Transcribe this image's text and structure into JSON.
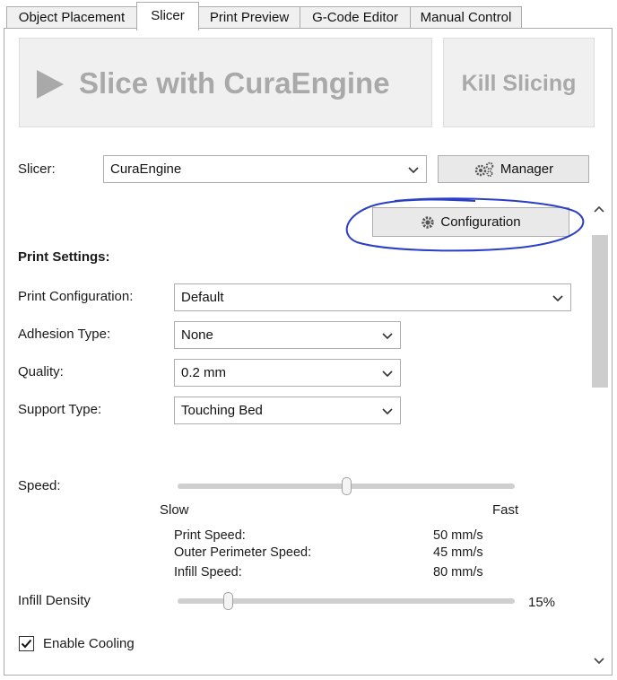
{
  "tabs": [
    {
      "label": "Object Placement"
    },
    {
      "label": "Slicer"
    },
    {
      "label": "Print Preview"
    },
    {
      "label": "G-Code Editor"
    },
    {
      "label": "Manual Control"
    }
  ],
  "actions": {
    "slice_label": "Slice with CuraEngine",
    "kill_label": "Kill Slicing"
  },
  "slicer": {
    "label": "Slicer:",
    "selected": "CuraEngine",
    "manager_label": "Manager",
    "configuration_label": "Configuration"
  },
  "print_settings": {
    "heading": "Print Settings:",
    "print_configuration": {
      "label": "Print Configuration:",
      "value": "Default"
    },
    "adhesion_type": {
      "label": "Adhesion Type:",
      "value": "None"
    },
    "quality": {
      "label": "Quality:",
      "value": "0.2 mm"
    },
    "support_type": {
      "label": "Support Type:",
      "value": "Touching Bed"
    }
  },
  "speed": {
    "label": "Speed:",
    "slow_label": "Slow",
    "fast_label": "Fast",
    "level": 0.5,
    "details": [
      {
        "name": "Print Speed:",
        "value": "50 mm/s"
      },
      {
        "name": "Outer Perimeter Speed:",
        "value": "45 mm/s"
      },
      {
        "name": "Infill Speed:",
        "value": "80 mm/s"
      }
    ]
  },
  "infill": {
    "label": "Infill Density",
    "value_text": "15%",
    "level": 0.15
  },
  "cooling": {
    "label": "Enable Cooling",
    "checked": true
  },
  "colors": {
    "highlight_circle": "#2b3fc4",
    "disabled_text": "#a9a9a9"
  }
}
